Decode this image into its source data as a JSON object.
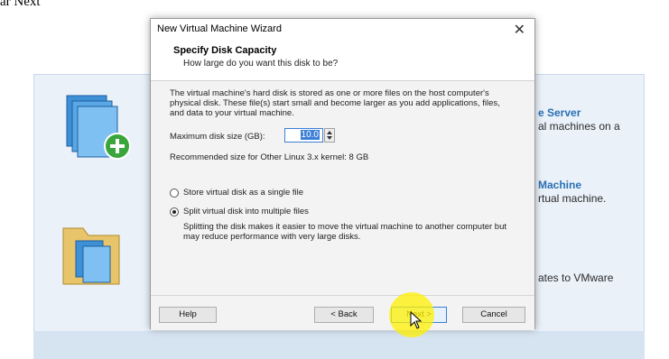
{
  "caption": "ar Next",
  "background": {
    "items": [
      {
        "title": "e Server",
        "desc": "al machines on a"
      },
      {
        "title": "Machine",
        "desc": "rtual machine."
      },
      {
        "title": "",
        "desc": "ates to VMware"
      }
    ]
  },
  "dialog": {
    "title": "New Virtual Machine Wizard",
    "close": "✕",
    "header_title": "Specify Disk Capacity",
    "header_subtitle": "How large do you want this disk to be?",
    "description": "The virtual machine's hard disk is stored as one or more files on the host computer's physical disk. These file(s) start small and become larger as you add applications, files, and data to your virtual machine.",
    "max_size_label": "Maximum disk size (GB):",
    "max_size_value": "10.0",
    "recommended": "Recommended size for Other Linux 3.x kernel: 8 GB",
    "options": [
      {
        "label": "Store virtual disk as a single file",
        "checked": false
      },
      {
        "label": "Split virtual disk into multiple files",
        "checked": true
      }
    ],
    "split_note": "Splitting the disk makes it easier to move the virtual machine to another computer but may reduce performance with very large disks.",
    "buttons": {
      "help": "Help",
      "back": "< Back",
      "next": "Next >",
      "cancel": "Cancel"
    }
  }
}
